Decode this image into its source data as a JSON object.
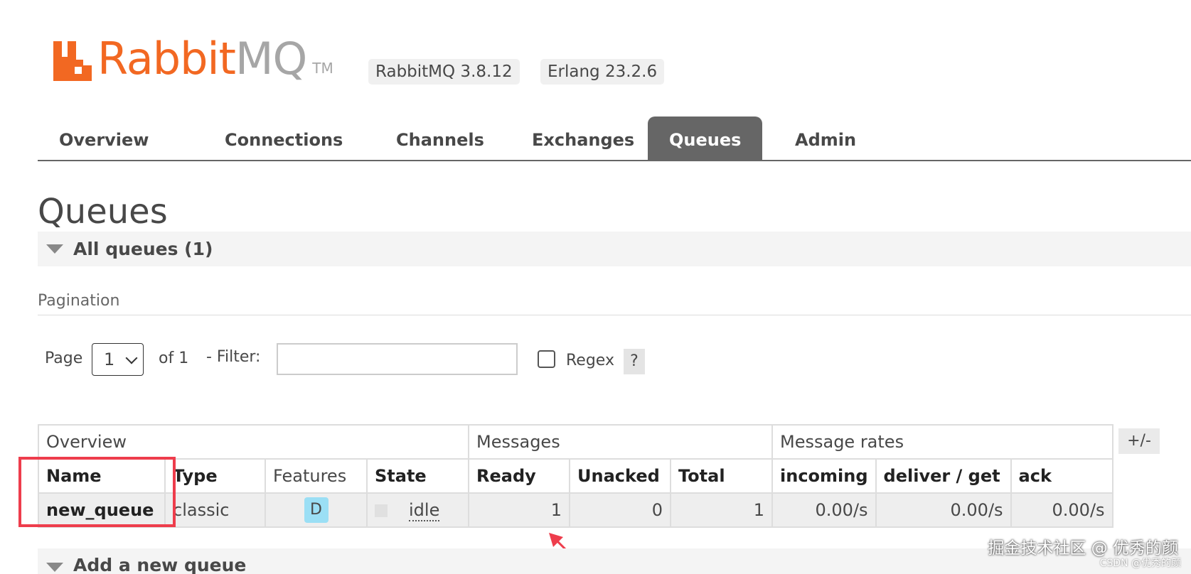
{
  "header": {
    "logo_brand": "Rabbit",
    "logo_suffix": "MQ",
    "logo_tm": "TM",
    "rabbitmq_version": "RabbitMQ 3.8.12",
    "erlang_version": "Erlang 23.2.6",
    "brand_color": "#f26822"
  },
  "nav": {
    "tabs": [
      {
        "label": "Overview"
      },
      {
        "label": "Connections"
      },
      {
        "label": "Channels"
      },
      {
        "label": "Exchanges"
      },
      {
        "label": "Queues",
        "active": true
      },
      {
        "label": "Admin"
      }
    ]
  },
  "page": {
    "title": "Queues",
    "section_all_queues": "All queues (1)",
    "section_add_queue": "Add a new queue"
  },
  "pagination": {
    "label": "Pagination",
    "page_label": "Page",
    "page_value": "1",
    "of_label": "of 1",
    "filter_label": "- Filter:",
    "filter_value": "",
    "regex_label": "Regex",
    "regex_checked": false,
    "help_label": "?"
  },
  "table": {
    "groups": [
      "Overview",
      "Messages",
      "Message rates"
    ],
    "columns": [
      "Name",
      "Type",
      "Features",
      "State",
      "Ready",
      "Unacked",
      "Total",
      "incoming",
      "deliver / get",
      "ack"
    ],
    "toggle_label": "+/-",
    "rows": [
      {
        "name": "new_queue",
        "type": "classic",
        "features": "D",
        "state": "idle",
        "ready": "1",
        "unacked": "0",
        "total": "1",
        "incoming": "0.00/s",
        "deliver_get": "0.00/s",
        "ack": "0.00/s"
      }
    ]
  },
  "watermark": {
    "main": "掘金技术社区 @ 优秀的颜",
    "sub": "CSDN @优秀的颜"
  }
}
